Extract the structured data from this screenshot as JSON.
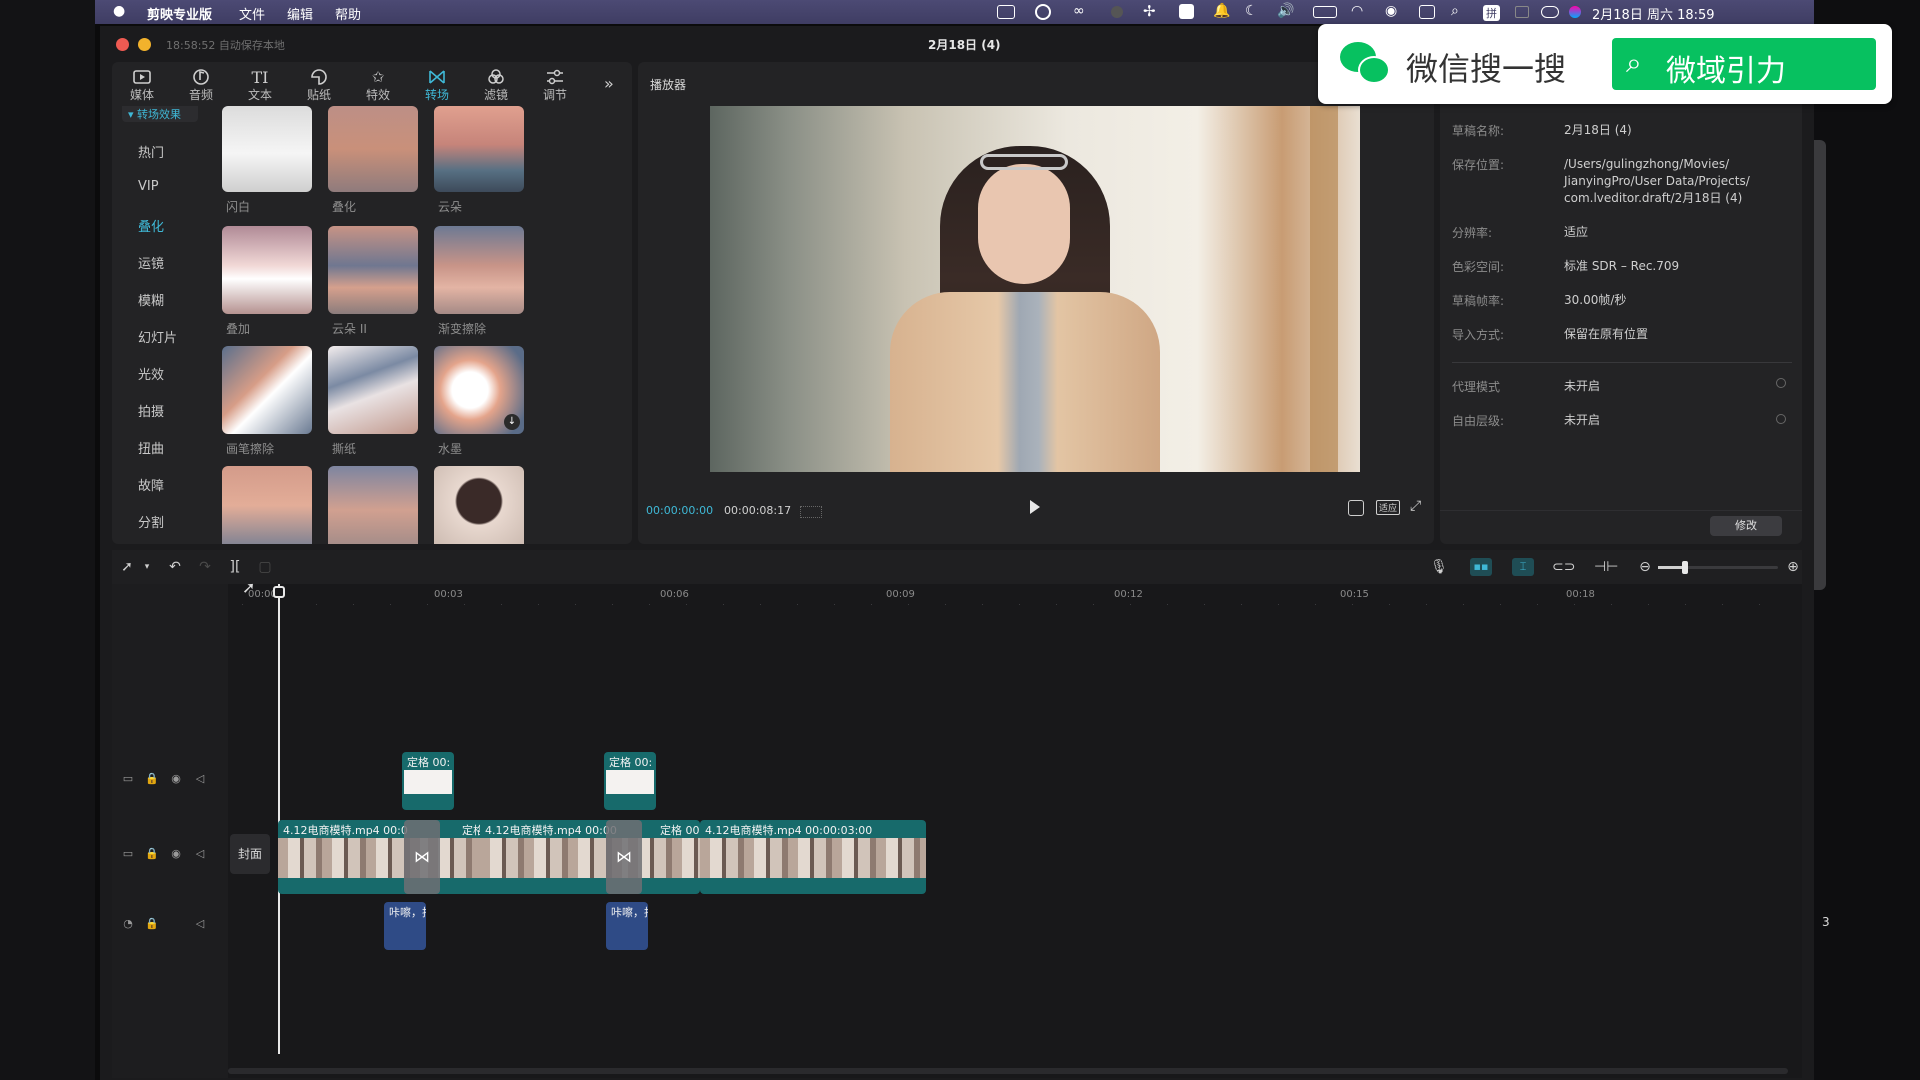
{
  "menubar": {
    "apple": "",
    "app_name": "剪映专业版",
    "menus": [
      "文件",
      "编辑",
      "帮助"
    ],
    "datetime": "2月18日 周六 18:59",
    "input_method": "拼"
  },
  "window": {
    "autosave": "18:58:52 自动保存本地",
    "title": "2月18日 (4)"
  },
  "toolbar": {
    "tabs": [
      {
        "label": "媒体",
        "icon": "media-icon"
      },
      {
        "label": "音频",
        "icon": "audio-icon"
      },
      {
        "label": "文本",
        "icon": "text-icon"
      },
      {
        "label": "贴纸",
        "icon": "sticker-icon"
      },
      {
        "label": "特效",
        "icon": "effects-icon"
      },
      {
        "label": "转场",
        "icon": "transition-icon"
      },
      {
        "label": "滤镜",
        "icon": "filter-icon"
      },
      {
        "label": "调节",
        "icon": "adjust-icon"
      }
    ],
    "active_tab": "转场",
    "more": "»"
  },
  "categories": {
    "header": "转场效果",
    "items": [
      "热门",
      "VIP",
      "叠化",
      "运镜",
      "模糊",
      "幻灯片",
      "光效",
      "拍摄",
      "扭曲",
      "故障",
      "分割"
    ],
    "active": "叠化"
  },
  "transitions": [
    {
      "label": "闪白"
    },
    {
      "label": "叠化"
    },
    {
      "label": "云朵"
    },
    {
      "label": "叠加"
    },
    {
      "label": "云朵 II"
    },
    {
      "label": "渐变擦除"
    },
    {
      "label": "画笔擦除"
    },
    {
      "label": "撕纸"
    },
    {
      "label": "水墨"
    },
    {
      "label": ""
    },
    {
      "label": ""
    },
    {
      "label": ""
    }
  ],
  "player": {
    "title": "播放器",
    "current_time": "00:00:00:00",
    "total_time": "00:00:08:17",
    "ratio_label": "适应"
  },
  "draft": {
    "rows": [
      {
        "label": "草稿名称:",
        "value": "2月18日 (4)"
      },
      {
        "label": "保存位置:",
        "value": "/Users/gulingzhong/Movies/ JianyingPro/User Data/Projects/ com.lveditor.draft/2月18日 (4)"
      },
      {
        "label": "分辨率:",
        "value": "适应"
      },
      {
        "label": "色彩空间:",
        "value": "标准 SDR – Rec.709"
      },
      {
        "label": "草稿帧率:",
        "value": "30.00帧/秒"
      },
      {
        "label": "导入方式:",
        "value": "保留在原有位置"
      }
    ],
    "rows2": [
      {
        "label": "代理模式",
        "value": "未开启"
      },
      {
        "label": "自由层级:",
        "value": "未开启"
      }
    ],
    "modify_button": "修改"
  },
  "watermark": {
    "left_text": "微信搜一搜",
    "right_text": "微域引力"
  },
  "timeline": {
    "ruler": [
      "00:00",
      "00:03",
      "00:06",
      "00:09",
      "00:12",
      "00:15",
      "00:18"
    ],
    "cover_label": "封面",
    "freeze_clips": [
      "定格  00:",
      "定格  00:"
    ],
    "main_clips": [
      "4.12电商模特.mp4   00:0",
      "定格   00:0",
      "4.12电商模特.mp4   00:00",
      "定格   00:0",
      "4.12电商模特.mp4   00:00:03:00"
    ],
    "audio_clips": [
      "咔嚓，拍",
      "咔嚓，拍"
    ],
    "side_number": "3"
  }
}
